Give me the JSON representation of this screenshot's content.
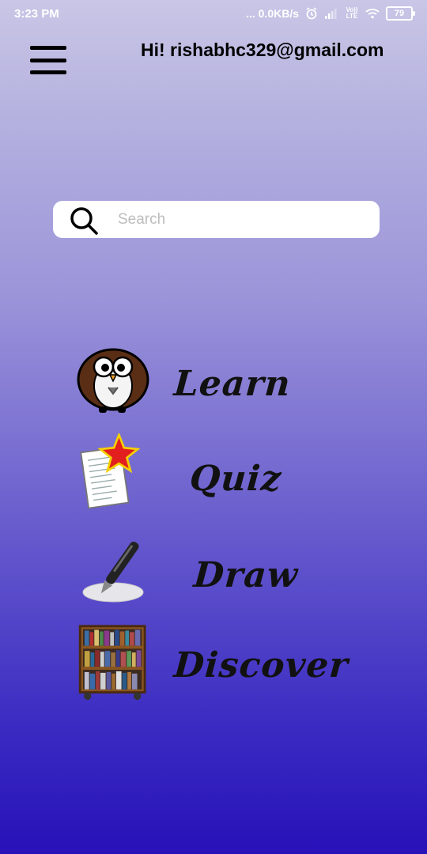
{
  "status_bar": {
    "time": "3:23 PM",
    "network_speed": "... 0.0KB/s",
    "volte_label": "Vo)) LTE",
    "battery_level": "79"
  },
  "header": {
    "menu_icon": "hamburger-menu-icon",
    "greeting": "Hi! rishabhc329@gmail.com"
  },
  "search": {
    "placeholder": "Search",
    "value": "",
    "icon": "search-icon"
  },
  "menu_items": [
    {
      "label": "Learn",
      "icon": "owl-icon"
    },
    {
      "label": "Quiz",
      "icon": "quiz-paper-star-icon"
    },
    {
      "label": "Draw",
      "icon": "pen-icon"
    },
    {
      "label": "Discover",
      "icon": "bookshelf-icon"
    }
  ],
  "colors": {
    "background_top": "#c9c6e6",
    "background_bottom": "#2711b8",
    "search_bg": "#ffffff"
  }
}
